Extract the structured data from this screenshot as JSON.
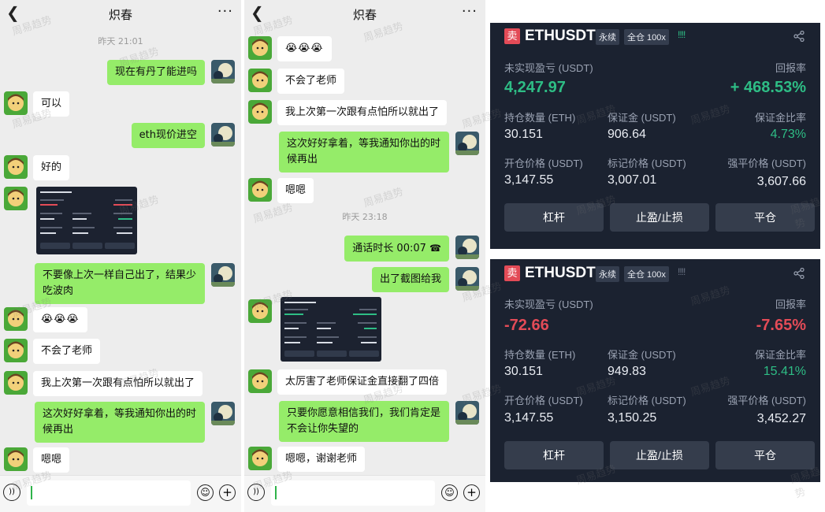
{
  "chat1": {
    "title": "炽春",
    "timestamp": "昨天 21:01",
    "messages": [
      {
        "text": "现在有丹了能进吗"
      },
      {
        "text": "可以"
      },
      {
        "text": "eth现价进空"
      },
      {
        "text": "好的"
      },
      {
        "text": "不要像上次一样自己出了，结果少吃波肉"
      },
      {
        "text": "😭😭😭"
      },
      {
        "text": "不会了老师"
      },
      {
        "text": "我上次第一次跟有点怕所以就出了"
      },
      {
        "text": "这次好好拿着，等我通知你出的时候再出"
      },
      {
        "text": "嗯嗯"
      }
    ]
  },
  "chat2": {
    "title": "炽春",
    "timestamp": "昨天 23:18",
    "messages": [
      {
        "text": "😭😭😭"
      },
      {
        "text": "不会了老师"
      },
      {
        "text": "我上次第一次跟有点怕所以就出了"
      },
      {
        "text": "这次好好拿着，等我通知你出的时候再出"
      },
      {
        "text": "嗯嗯"
      },
      {
        "text": "通话时长 00:07"
      },
      {
        "text": "出了截图给我"
      },
      {
        "text": "太厉害了老师保证金直接翻了四倍"
      },
      {
        "text": "只要你愿意相信我们，我们肯定是不会让你失望的"
      },
      {
        "text": "嗯嗯，谢谢老师"
      }
    ]
  },
  "watermark": "周易趋势",
  "icons": [
    "back-icon",
    "more-icon",
    "voice-icon",
    "emoji-icon",
    "add-icon",
    "share-icon",
    "phone-icon"
  ],
  "colors": {
    "up": "#2ebd85",
    "down": "#e34b57",
    "bubble_me": "#95ec69",
    "card_bg": "#1b2230"
  },
  "cards": [
    {
      "badge": "卖",
      "symbol": "ETHUSDT",
      "perp": "永续",
      "mode": "全仓 100x",
      "signal": "!!!!",
      "pnl_label": "未实现盈亏 (USDT)",
      "roe_label": "回报率",
      "pnl": "4,247.97",
      "roe": "+ 468.53%",
      "qty_label": "持仓数量 (ETH)",
      "margin_label": "保证金 (USDT)",
      "ratio_label": "保证金比率",
      "qty": "30.151",
      "margin": "906.64",
      "ratio": "4.73%",
      "entry_label": "开仓价格 (USDT)",
      "mark_label": "标记价格 (USDT)",
      "liq_label": "强平价格 (USDT)",
      "entry": "3,147.55",
      "mark": "3,007.01",
      "liq": "3,607.66",
      "btn_leverage": "杠杆",
      "btn_tpsl": "止盈/止损",
      "btn_close": "平仓"
    },
    {
      "badge": "卖",
      "symbol": "ETHUSDT",
      "perp": "永续",
      "mode": "全仓 100x",
      "signal": "!!!!",
      "pnl_label": "未实现盈亏 (USDT)",
      "roe_label": "回报率",
      "pnl": "-72.66",
      "roe": "-7.65%",
      "qty_label": "持仓数量 (ETH)",
      "margin_label": "保证金 (USDT)",
      "ratio_label": "保证金比率",
      "qty": "30.151",
      "margin": "949.83",
      "ratio": "15.41%",
      "entry_label": "开仓价格 (USDT)",
      "mark_label": "标记价格 (USDT)",
      "liq_label": "强平价格 (USDT)",
      "entry": "3,147.55",
      "mark": "3,150.25",
      "liq": "3,452.27",
      "btn_leverage": "杠杆",
      "btn_tpsl": "止盈/止损",
      "btn_close": "平仓"
    }
  ]
}
